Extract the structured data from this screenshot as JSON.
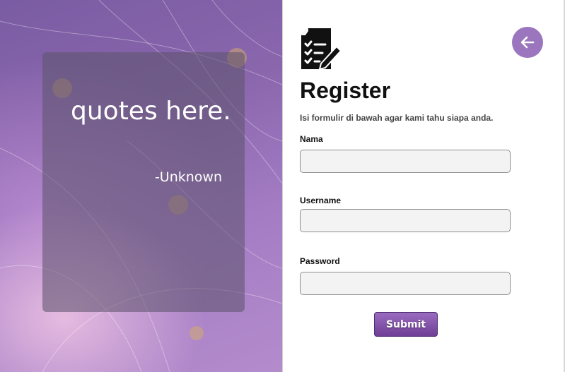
{
  "quote_panel": {
    "quote": "quotes here.",
    "author": "-Unknown"
  },
  "form": {
    "icon": "form-checklist-icon",
    "back_icon": "arrow-left-icon",
    "title": "Register",
    "subtitle": "Isi formulir di bawah agar kami tahu siapa anda.",
    "fields": [
      {
        "label": "Nama",
        "value": ""
      },
      {
        "label": "Username",
        "value": ""
      },
      {
        "label": "Password",
        "value": ""
      }
    ],
    "submit_label": "Submit"
  },
  "colors": {
    "accent": "#9b76be",
    "button_gradient_top": "#9a6cc0",
    "button_gradient_bottom": "#6f3f96",
    "panel_background": "#8a66ad"
  }
}
